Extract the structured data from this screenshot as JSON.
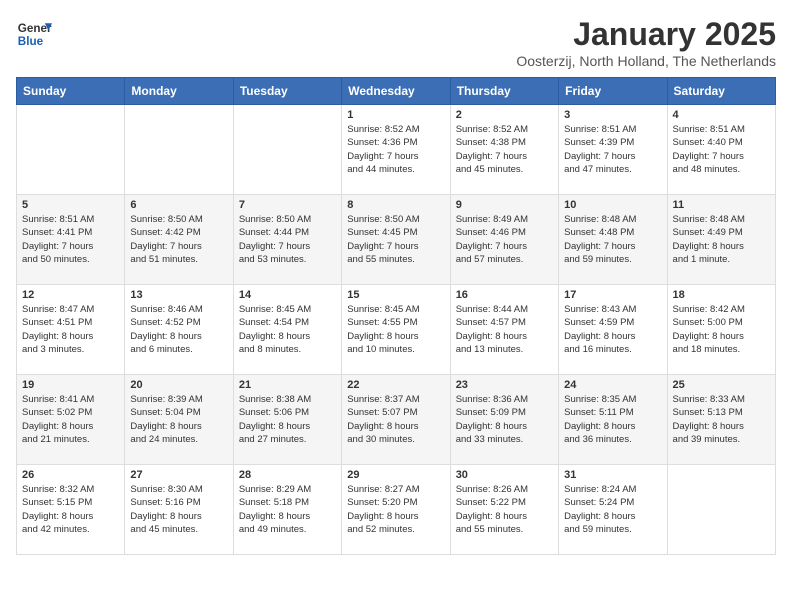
{
  "header": {
    "logo_line1": "General",
    "logo_line2": "Blue",
    "month": "January 2025",
    "location": "Oosterzij, North Holland, The Netherlands"
  },
  "days_of_week": [
    "Sunday",
    "Monday",
    "Tuesday",
    "Wednesday",
    "Thursday",
    "Friday",
    "Saturday"
  ],
  "weeks": [
    [
      {
        "day": "",
        "info": ""
      },
      {
        "day": "",
        "info": ""
      },
      {
        "day": "",
        "info": ""
      },
      {
        "day": "1",
        "info": "Sunrise: 8:52 AM\nSunset: 4:36 PM\nDaylight: 7 hours\nand 44 minutes."
      },
      {
        "day": "2",
        "info": "Sunrise: 8:52 AM\nSunset: 4:38 PM\nDaylight: 7 hours\nand 45 minutes."
      },
      {
        "day": "3",
        "info": "Sunrise: 8:51 AM\nSunset: 4:39 PM\nDaylight: 7 hours\nand 47 minutes."
      },
      {
        "day": "4",
        "info": "Sunrise: 8:51 AM\nSunset: 4:40 PM\nDaylight: 7 hours\nand 48 minutes."
      }
    ],
    [
      {
        "day": "5",
        "info": "Sunrise: 8:51 AM\nSunset: 4:41 PM\nDaylight: 7 hours\nand 50 minutes."
      },
      {
        "day": "6",
        "info": "Sunrise: 8:50 AM\nSunset: 4:42 PM\nDaylight: 7 hours\nand 51 minutes."
      },
      {
        "day": "7",
        "info": "Sunrise: 8:50 AM\nSunset: 4:44 PM\nDaylight: 7 hours\nand 53 minutes."
      },
      {
        "day": "8",
        "info": "Sunrise: 8:50 AM\nSunset: 4:45 PM\nDaylight: 7 hours\nand 55 minutes."
      },
      {
        "day": "9",
        "info": "Sunrise: 8:49 AM\nSunset: 4:46 PM\nDaylight: 7 hours\nand 57 minutes."
      },
      {
        "day": "10",
        "info": "Sunrise: 8:48 AM\nSunset: 4:48 PM\nDaylight: 7 hours\nand 59 minutes."
      },
      {
        "day": "11",
        "info": "Sunrise: 8:48 AM\nSunset: 4:49 PM\nDaylight: 8 hours\nand 1 minute."
      }
    ],
    [
      {
        "day": "12",
        "info": "Sunrise: 8:47 AM\nSunset: 4:51 PM\nDaylight: 8 hours\nand 3 minutes."
      },
      {
        "day": "13",
        "info": "Sunrise: 8:46 AM\nSunset: 4:52 PM\nDaylight: 8 hours\nand 6 minutes."
      },
      {
        "day": "14",
        "info": "Sunrise: 8:45 AM\nSunset: 4:54 PM\nDaylight: 8 hours\nand 8 minutes."
      },
      {
        "day": "15",
        "info": "Sunrise: 8:45 AM\nSunset: 4:55 PM\nDaylight: 8 hours\nand 10 minutes."
      },
      {
        "day": "16",
        "info": "Sunrise: 8:44 AM\nSunset: 4:57 PM\nDaylight: 8 hours\nand 13 minutes."
      },
      {
        "day": "17",
        "info": "Sunrise: 8:43 AM\nSunset: 4:59 PM\nDaylight: 8 hours\nand 16 minutes."
      },
      {
        "day": "18",
        "info": "Sunrise: 8:42 AM\nSunset: 5:00 PM\nDaylight: 8 hours\nand 18 minutes."
      }
    ],
    [
      {
        "day": "19",
        "info": "Sunrise: 8:41 AM\nSunset: 5:02 PM\nDaylight: 8 hours\nand 21 minutes."
      },
      {
        "day": "20",
        "info": "Sunrise: 8:39 AM\nSunset: 5:04 PM\nDaylight: 8 hours\nand 24 minutes."
      },
      {
        "day": "21",
        "info": "Sunrise: 8:38 AM\nSunset: 5:06 PM\nDaylight: 8 hours\nand 27 minutes."
      },
      {
        "day": "22",
        "info": "Sunrise: 8:37 AM\nSunset: 5:07 PM\nDaylight: 8 hours\nand 30 minutes."
      },
      {
        "day": "23",
        "info": "Sunrise: 8:36 AM\nSunset: 5:09 PM\nDaylight: 8 hours\nand 33 minutes."
      },
      {
        "day": "24",
        "info": "Sunrise: 8:35 AM\nSunset: 5:11 PM\nDaylight: 8 hours\nand 36 minutes."
      },
      {
        "day": "25",
        "info": "Sunrise: 8:33 AM\nSunset: 5:13 PM\nDaylight: 8 hours\nand 39 minutes."
      }
    ],
    [
      {
        "day": "26",
        "info": "Sunrise: 8:32 AM\nSunset: 5:15 PM\nDaylight: 8 hours\nand 42 minutes."
      },
      {
        "day": "27",
        "info": "Sunrise: 8:30 AM\nSunset: 5:16 PM\nDaylight: 8 hours\nand 45 minutes."
      },
      {
        "day": "28",
        "info": "Sunrise: 8:29 AM\nSunset: 5:18 PM\nDaylight: 8 hours\nand 49 minutes."
      },
      {
        "day": "29",
        "info": "Sunrise: 8:27 AM\nSunset: 5:20 PM\nDaylight: 8 hours\nand 52 minutes."
      },
      {
        "day": "30",
        "info": "Sunrise: 8:26 AM\nSunset: 5:22 PM\nDaylight: 8 hours\nand 55 minutes."
      },
      {
        "day": "31",
        "info": "Sunrise: 8:24 AM\nSunset: 5:24 PM\nDaylight: 8 hours\nand 59 minutes."
      },
      {
        "day": "",
        "info": ""
      }
    ]
  ]
}
